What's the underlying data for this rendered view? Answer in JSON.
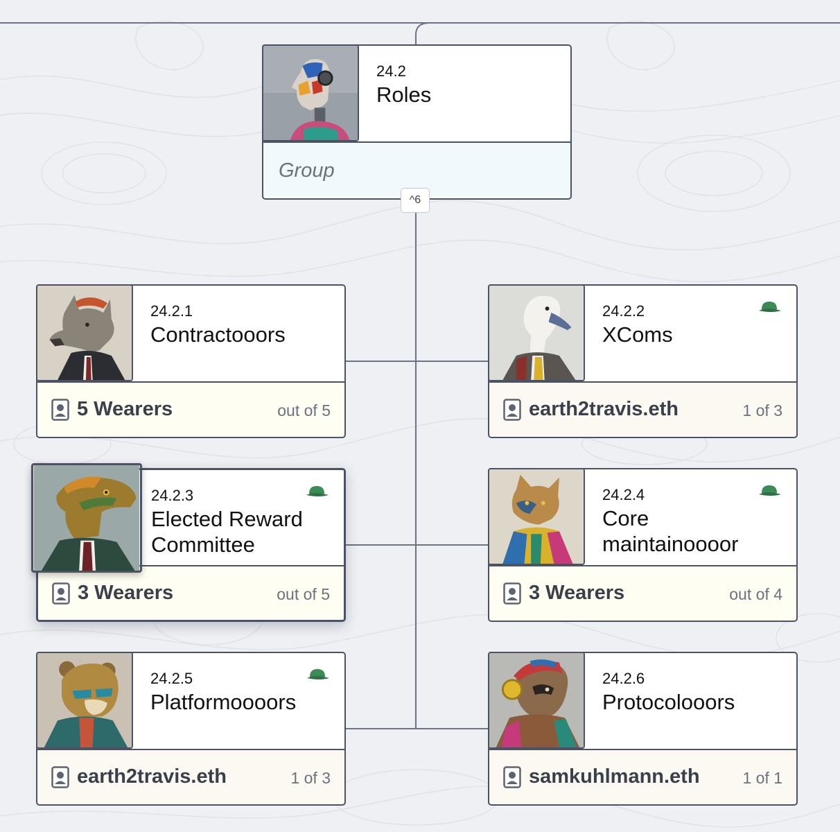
{
  "collapse_toggle": {
    "label": "^6"
  },
  "root": {
    "id": "24.2",
    "name": "Roles",
    "type_label": "Group"
  },
  "roles": [
    {
      "id": "24.2.1",
      "name": "Contractooors",
      "wearers": "5 Wearers",
      "count": "out of 5",
      "has_cap": false,
      "avatar": "wolf-portrait"
    },
    {
      "id": "24.2.2",
      "name": "XComs",
      "wearers": "earth2travis.eth",
      "count": "1 of 3",
      "has_cap": true,
      "avatar": "goose-portrait"
    },
    {
      "id": "24.2.3",
      "name": "Elected Reward Committee",
      "wearers": "3 Wearers",
      "count": "out of 5",
      "has_cap": true,
      "avatar": "iguana-portrait"
    },
    {
      "id": "24.2.4",
      "name": "Core maintainoooor",
      "wearers": "3 Wearers",
      "count": "out of 4",
      "has_cap": true,
      "avatar": "cat-portrait"
    },
    {
      "id": "24.2.5",
      "name": "Platformoooors",
      "wearers": "earth2travis.eth",
      "count": "1 of 3",
      "has_cap": true,
      "avatar": "bear-portrait"
    },
    {
      "id": "24.2.6",
      "name": "Protocolooors",
      "wearers": "samkuhlmann.eth",
      "count": "1 of 1",
      "has_cap": false,
      "avatar": "sloth-portrait"
    }
  ],
  "colors": {
    "border": "#4a5263",
    "cap_green": "#3c8a55",
    "cream": "#fefef2",
    "beige": "#fcf9f3",
    "blue": "#f2f9fc"
  }
}
